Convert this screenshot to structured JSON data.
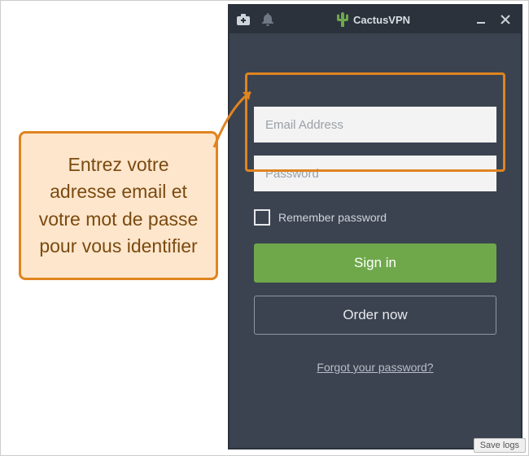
{
  "brand": {
    "name": "CactusVPN"
  },
  "login": {
    "email_placeholder": "Email Address",
    "password_placeholder": "Password",
    "remember_label": "Remember password",
    "sign_in_label": "Sign in",
    "order_now_label": "Order now",
    "forgot_label": "Forgot your password?"
  },
  "footer": {
    "save_logs": "Save logs"
  },
  "callout": {
    "text": "Entrez votre adresse email et votre mot de passe pour vous identifier"
  },
  "colors": {
    "accent_orange": "#e08420",
    "accent_green": "#6fa84b",
    "panel_bg": "#3b4350"
  }
}
